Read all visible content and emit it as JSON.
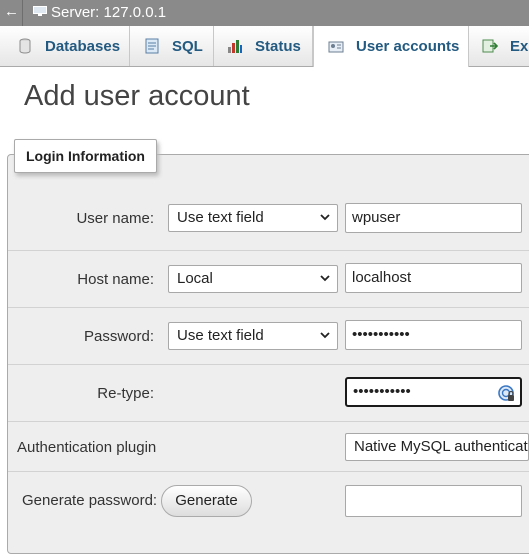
{
  "topbar": {
    "back_glyph": "←",
    "server_label": "Server: 127.0.0.1",
    "icon": "server-icon"
  },
  "tabs": [
    {
      "label": "Databases",
      "icon": "database-icon"
    },
    {
      "label": "SQL",
      "icon": "sql-icon"
    },
    {
      "label": "Status",
      "icon": "status-icon"
    },
    {
      "label": "User accounts",
      "icon": "user-accounts-icon",
      "active": true
    },
    {
      "label": "Ex",
      "icon": "export-icon"
    }
  ],
  "page": {
    "title": "Add user account"
  },
  "login_info": {
    "legend": "Login Information",
    "user_name": {
      "label": "User name:",
      "select": "Use text field",
      "value": "wpuser"
    },
    "host_name": {
      "label": "Host name:",
      "select": "Local",
      "value": "localhost"
    },
    "password": {
      "label": "Password:",
      "select": "Use text field",
      "value": "•••••••••••"
    },
    "retype": {
      "label": "Re-type:",
      "value": "•••••••••••"
    },
    "auth_plugin": {
      "label": "Authentication plugin",
      "value": "Native MySQL authentication"
    },
    "generate": {
      "label": "Generate password:",
      "button": "Generate",
      "value": ""
    }
  },
  "colors": {
    "tab_text": "#235a81",
    "topbar": "#8a8a8a",
    "fieldset_bg": "#eeeeee"
  }
}
